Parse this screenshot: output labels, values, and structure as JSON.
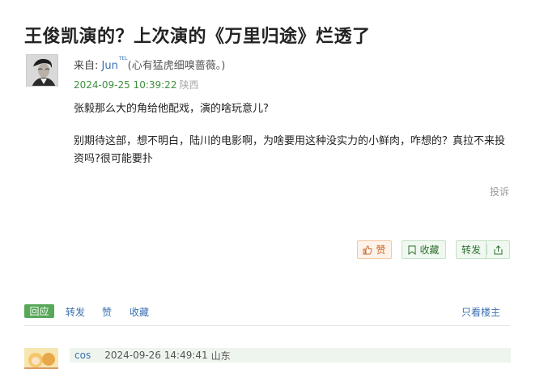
{
  "thread": {
    "title": "王俊凯演的？上次演的《万里归途》烂透了"
  },
  "post": {
    "from_label": "来自: ",
    "author": "Jun",
    "author_badge": "TEL",
    "signature": "(心有猛虎细嗅蔷薇。)",
    "timestamp": "2024-09-25 10:39:22",
    "location": "陕西",
    "paragraphs": [
      "张毅那么大的角给他配戏，演的啥玩意儿?",
      "别期待这部，想不明白，陆川的电影啊，为啥要用这种没实力的小鲜肉，咋想的？真拉不来投资吗?很可能要扑"
    ],
    "report_label": "投诉",
    "like_label": "赞",
    "favorite_label": "收藏",
    "share_label": "转发"
  },
  "toolbar": {
    "reply_label": "回应",
    "repost_label": "转发",
    "like_label": "赞",
    "favorite_label": "收藏",
    "owner_only_label": "只看楼主"
  },
  "reply": {
    "author": "cos",
    "timestamp": "2024-09-26 14:49:41",
    "location": "山东"
  },
  "colors": {
    "link": "#3a6fb0",
    "time_green": "#3d8f3d",
    "reply_button": "#58a85a",
    "like_orange": "#c8672a"
  }
}
